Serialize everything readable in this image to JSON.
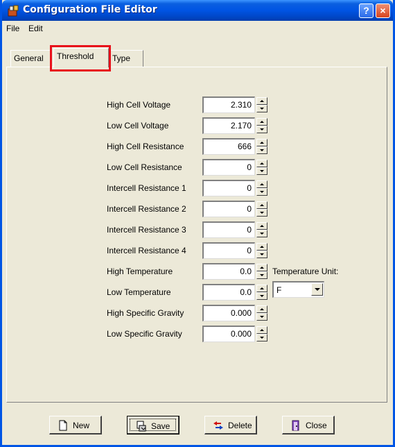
{
  "window": {
    "title": "Configuration File Editor",
    "help_label": "?",
    "close_label": "×"
  },
  "menu": {
    "file": "File",
    "edit": "Edit"
  },
  "tabs": [
    {
      "label": "General",
      "active": false
    },
    {
      "label": "Threshold",
      "active": true
    },
    {
      "label": "Type",
      "active": false
    }
  ],
  "fields": [
    {
      "label": "High Cell Voltage",
      "value": "2.310"
    },
    {
      "label": "Low Cell Voltage",
      "value": "2.170"
    },
    {
      "label": "High Cell Resistance",
      "value": "666"
    },
    {
      "label": "Low Cell Resistance",
      "value": "0"
    },
    {
      "label": "Intercell Resistance 1",
      "value": "0"
    },
    {
      "label": "Intercell Resistance 2",
      "value": "0"
    },
    {
      "label": "Intercell Resistance 3",
      "value": "0"
    },
    {
      "label": "Intercell Resistance 4",
      "value": "0"
    },
    {
      "label": "High Temperature",
      "value": "0.0"
    },
    {
      "label": "Low Temperature",
      "value": "0.0"
    },
    {
      "label": "High Specific Gravity",
      "value": "0.000"
    },
    {
      "label": "Low Specific Gravity",
      "value": "0.000"
    }
  ],
  "temperature_unit": {
    "label": "Temperature Unit:",
    "selected": "F"
  },
  "buttons": {
    "new": "New",
    "save": "Save",
    "delete": "Delete",
    "close": "Close"
  },
  "colors": {
    "titlebar": "#0054e3",
    "window_bg": "#ece9d8",
    "highlight_box": "#e8101a"
  }
}
